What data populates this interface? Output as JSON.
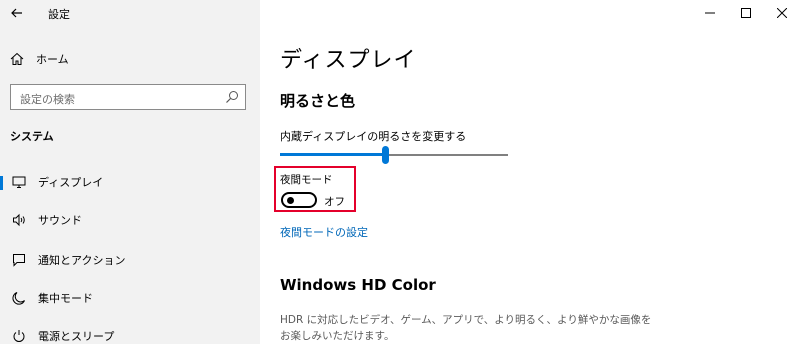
{
  "app": {
    "title": "設定"
  },
  "sidebar": {
    "home_label": "ホーム",
    "search_placeholder": "設定の検索",
    "section_title": "システム",
    "items": [
      {
        "label": "ディスプレイ",
        "icon": "monitor-icon",
        "active": true
      },
      {
        "label": "サウンド",
        "icon": "speaker-icon",
        "active": false
      },
      {
        "label": "通知とアクション",
        "icon": "message-icon",
        "active": false
      },
      {
        "label": "集中モード",
        "icon": "moon-icon",
        "active": false
      },
      {
        "label": "電源とスリープ",
        "icon": "power-icon",
        "active": false
      }
    ]
  },
  "main": {
    "title": "ディスプレイ",
    "brightness_heading": "明るさと色",
    "slider_label": "内蔵ディスプレイの明るさを変更する",
    "brightness_value": 0.46,
    "night_light_label": "夜間モード",
    "night_light_state": "オフ",
    "night_light_link": "夜間モードの設定",
    "hd_heading": "Windows HD Color",
    "hd_description": "HDR に対応したビデオ、ゲーム、アプリで、より明るく、より鮮やかな画像をお楽しみいただけます。"
  },
  "colors": {
    "accent": "#0078d7",
    "highlight_box": "#e4002b",
    "link": "#0067b8"
  }
}
